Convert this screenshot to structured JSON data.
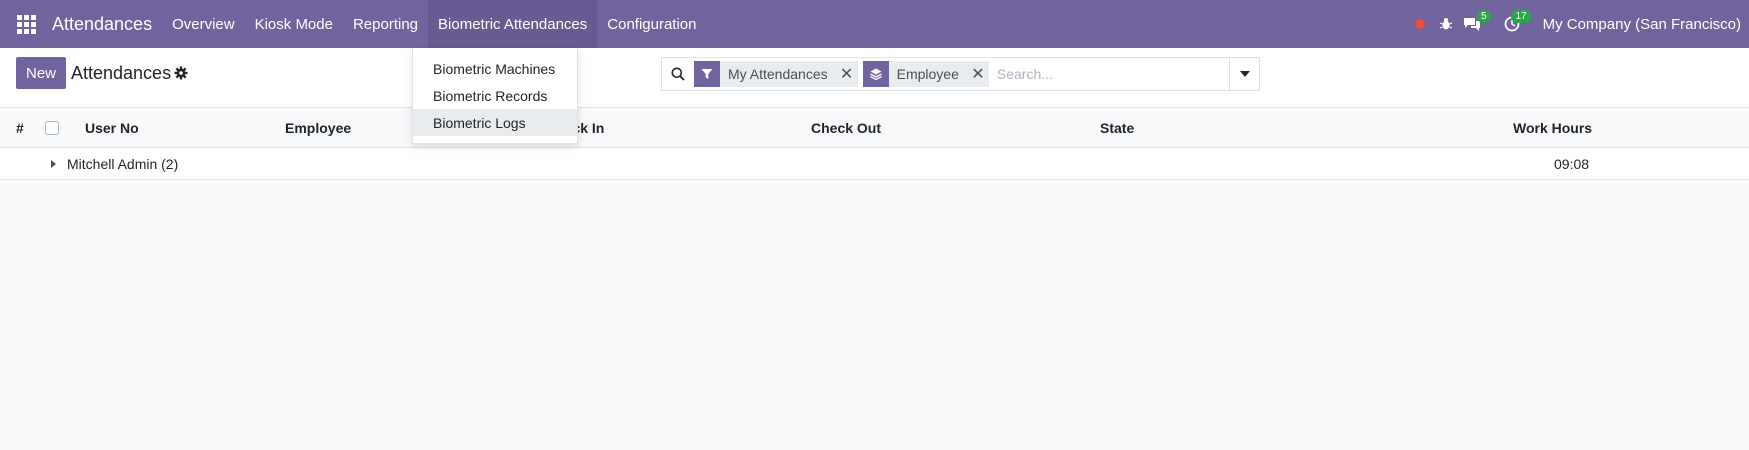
{
  "navbar": {
    "app_name": "Attendances",
    "menus": [
      {
        "label": "Overview"
      },
      {
        "label": "Kiosk Mode"
      },
      {
        "label": "Reporting"
      },
      {
        "label": "Biometric Attendances"
      },
      {
        "label": "Configuration"
      }
    ],
    "messages_count": "5",
    "activities_count": "17",
    "company": "My Company (San Francisco)"
  },
  "dropdown": {
    "items": [
      {
        "label": "Biometric Machines"
      },
      {
        "label": "Biometric Records"
      },
      {
        "label": "Biometric Logs"
      }
    ]
  },
  "control_panel": {
    "new_label": "New",
    "title": "Attendances"
  },
  "search": {
    "facets": [
      {
        "label": "My Attendances",
        "icon": "filter-icon"
      },
      {
        "label": "Employee",
        "icon": "layers-icon"
      }
    ],
    "placeholder": "Search..."
  },
  "table": {
    "columns": [
      "#",
      "User No",
      "Employee",
      "Check In",
      "Check Out",
      "State",
      "Work Hours"
    ],
    "groups": [
      {
        "label": "Mitchell Admin (2)",
        "work_hours": "09:08"
      }
    ]
  },
  "colors": {
    "brand": "#71639e",
    "badge": "#28a745",
    "debug_red": "#e74c3c"
  }
}
